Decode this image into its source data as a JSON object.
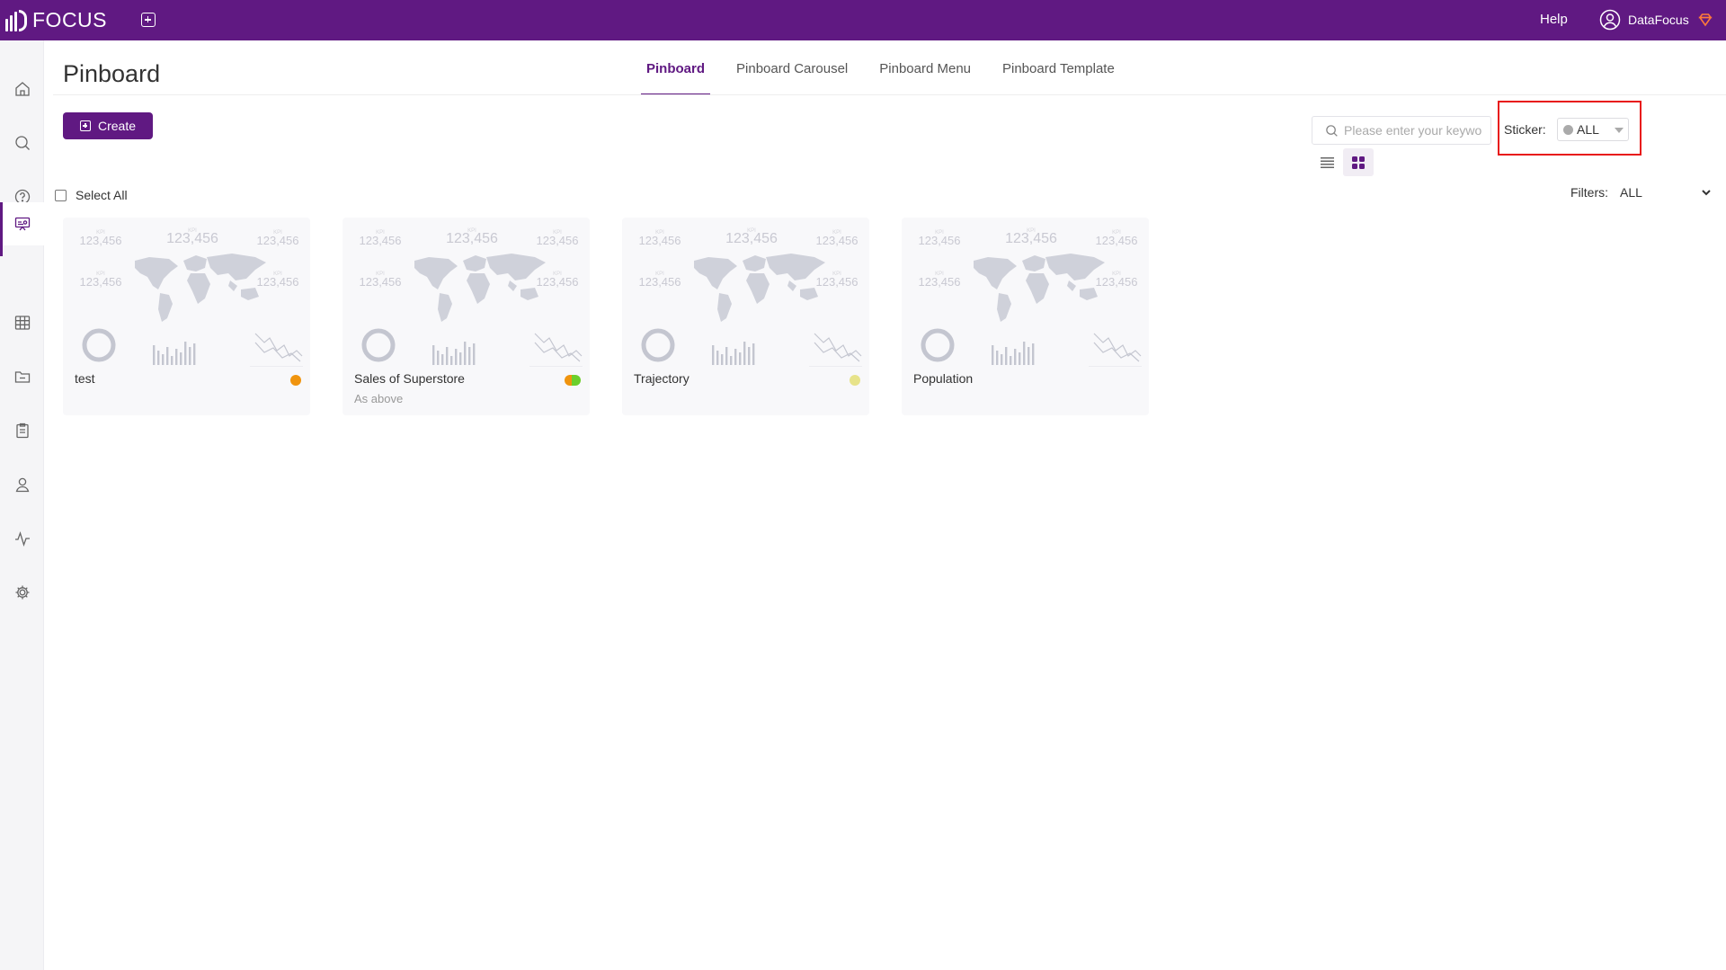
{
  "app": {
    "logo_text": "FOCUS"
  },
  "topbar": {
    "help_label": "Help",
    "user_name": "DataFocus"
  },
  "sidebar": {
    "items": [
      {
        "name": "home-icon",
        "active": false
      },
      {
        "name": "search-icon",
        "active": false
      },
      {
        "name": "question-icon",
        "active": false
      },
      {
        "name": "pinboard-icon",
        "active": true
      },
      {
        "name": "table-icon",
        "active": false
      },
      {
        "name": "folder-icon",
        "active": false
      },
      {
        "name": "clipboard-icon",
        "active": false
      },
      {
        "name": "user-icon",
        "active": false
      },
      {
        "name": "pulse-icon",
        "active": false
      },
      {
        "name": "settings-icon",
        "active": false
      }
    ]
  },
  "page": {
    "title": "Pinboard"
  },
  "tabs": [
    {
      "label": "Pinboard",
      "active": true
    },
    {
      "label": "Pinboard Carousel",
      "active": false
    },
    {
      "label": "Pinboard Menu",
      "active": false
    },
    {
      "label": "Pinboard Template",
      "active": false
    }
  ],
  "toolbar": {
    "create_label": "Create",
    "search_placeholder": "Please enter your keywo",
    "sticker_label": "Sticker:",
    "sticker_value": "ALL",
    "select_all_label": "Select All",
    "filters_label": "Filters:",
    "filters_value": "ALL"
  },
  "thumbnail": {
    "kpi_label": "KPI",
    "kpi_value": "123,456"
  },
  "cards": [
    {
      "title": "test",
      "subtitle": "",
      "sticker_colors": [
        "#f0940e"
      ]
    },
    {
      "title": "Sales of Superstore",
      "subtitle": "As above",
      "sticker_colors": [
        "#f0940e",
        "#6ccf2c"
      ]
    },
    {
      "title": "Trajectory",
      "subtitle": "",
      "sticker_colors": [
        "#e7e38a"
      ]
    },
    {
      "title": "Population",
      "subtitle": "",
      "sticker_colors": []
    }
  ],
  "colors": {
    "brand": "#601982",
    "highlight_border": "#e81818"
  }
}
